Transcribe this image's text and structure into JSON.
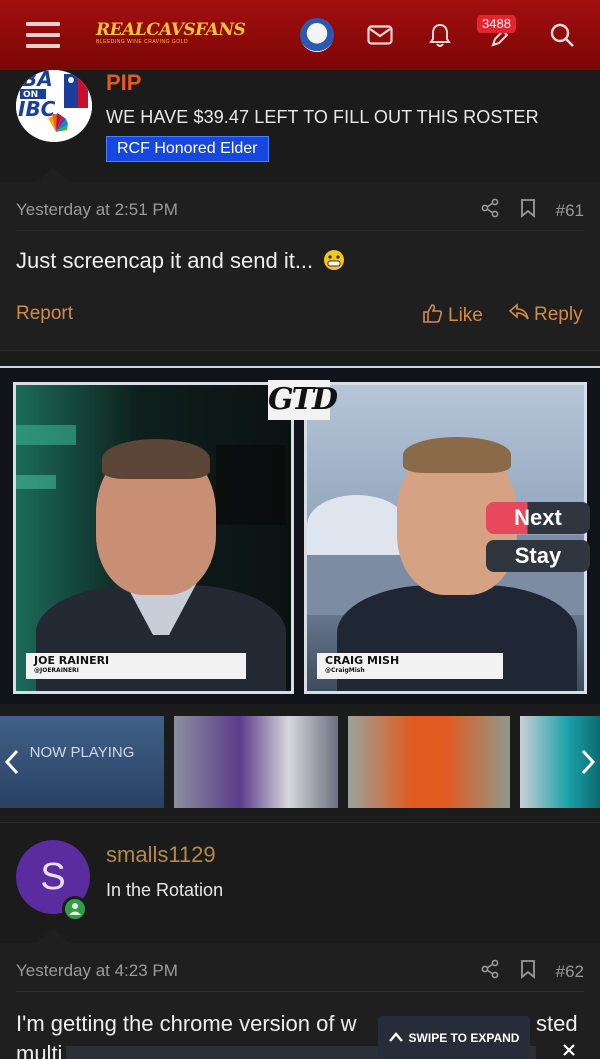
{
  "topbar": {
    "logo_text": "REALCAVSFANS",
    "logo_tagline": "BLEEDING WINE CRAVING GOLD",
    "notification_count": "3488",
    "icons": [
      "menu-icon",
      "mail-icon",
      "bell-icon",
      "pencil-icon",
      "search-icon"
    ]
  },
  "post1": {
    "username": "PIP",
    "user_title": "WE HAVE $39.47 LEFT TO FILL OUT THIS ROSTER",
    "user_role": "RCF Honored Elder",
    "timestamp": "Yesterday at 2:51 PM",
    "post_number": "#61",
    "message": "Just screencap it and send it...",
    "report_label": "Report",
    "like_label": "Like",
    "reply_label": "Reply"
  },
  "video": {
    "show_logo": "GTD",
    "left_name": "JOE RAINERI",
    "left_handle": "@JOERAINERI",
    "right_name": "CRAIG MISH",
    "right_handle": "@CraigMish",
    "next_label": "Next",
    "stay_label": "Stay",
    "now_playing_label": "NOW PLAYING",
    "swipe_label": "SWIPE TO EXPAND"
  },
  "post2": {
    "username": "smalls1129",
    "avatar_letter": "S",
    "user_title": "In the Rotation",
    "timestamp": "Yesterday at 4:23 PM",
    "post_number": "#62",
    "message_line1_a": "I'm getting the chrome version of w",
    "message_line1_b": "sted",
    "message_line2": "multi"
  },
  "colors": {
    "topbar": "#8f0b0b",
    "username_pip": "#e15a1f",
    "username_smalls": "#b58a49",
    "role_badge": "#1648e0",
    "action_link": "#d68a47",
    "avatar_s": "#5b2ca0"
  }
}
